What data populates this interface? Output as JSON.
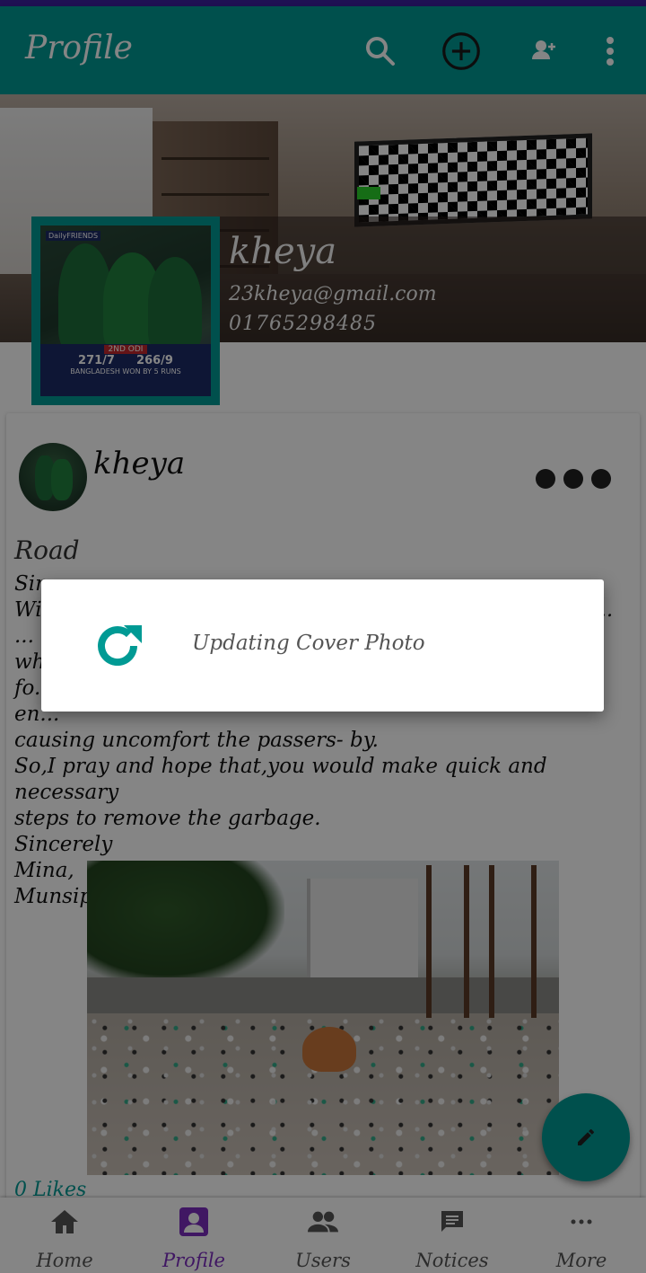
{
  "appbar": {
    "title": "Profile",
    "icons": [
      "search-icon",
      "add-circle-icon",
      "add-user-icon",
      "more-vert-icon"
    ]
  },
  "profile": {
    "name": "kheya",
    "email": "23kheya@gmail.com",
    "phone": "01765298485"
  },
  "avatar_image": {
    "brand": "DailyFRIENDS",
    "headline": "2ND ODI",
    "score_left": "271/7",
    "score_right": "266/9",
    "footer": "BANGLADESH WON BY 5 RUNS"
  },
  "post": {
    "author": "kheya",
    "title": "Road",
    "body": "Sir,\nWith due respect ... ... ... ... ... ... ... ... ... ... ... ... ... ... ... ... ... ... y\nwh...\nfo... ... ... ... ... ... ... ... ... ... ... ... ... ... ... ... ... ... ng\nen...\ncausing uncomfort the passers- by.\nSo,I pray and hope that,you would make quick and necessary\nsteps to remove the garbage.\nSincerely\nMina,\nMunsipara,Pirgang",
    "likes": "0 Likes"
  },
  "dialog": {
    "message": "Updating Cover Photo",
    "icon": "refresh-icon"
  },
  "fab": {
    "icon": "edit-icon"
  },
  "bottom_nav": {
    "items": [
      {
        "label": "Home",
        "icon": "home-icon"
      },
      {
        "label": "Profile",
        "icon": "profile-icon"
      },
      {
        "label": "Users",
        "icon": "users-icon"
      },
      {
        "label": "Notices",
        "icon": "notices-icon"
      },
      {
        "label": "More",
        "icon": "more-horiz-icon"
      }
    ],
    "active": "Profile"
  },
  "colors": {
    "primary": "#009a94",
    "accent": "#7b2cbf",
    "statusbar": "#3d1fa0"
  }
}
